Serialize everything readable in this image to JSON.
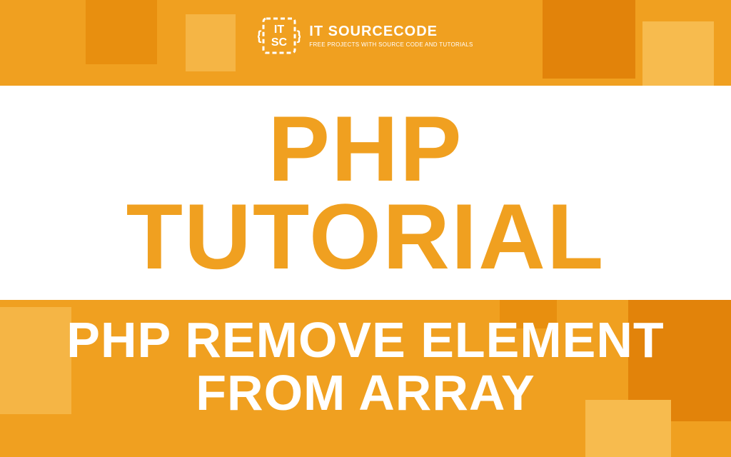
{
  "logo": {
    "title": "IT SOURCECODE",
    "tagline": "FREE PROJECTS WITH SOURCE CODE AND TUTORIALS",
    "monogram_top": "IT",
    "monogram_bottom": "SC"
  },
  "main": {
    "line1": "PHP",
    "line2": "TUTORIAL"
  },
  "subtitle": {
    "line1": "PHP REMOVE ELEMENT",
    "line2": "FROM ARRAY"
  }
}
